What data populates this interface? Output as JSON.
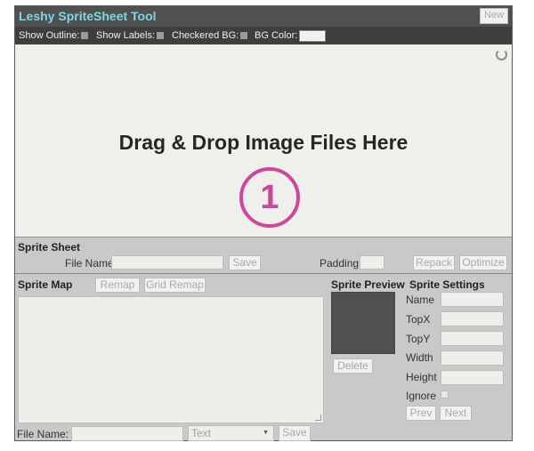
{
  "app": {
    "title": "Leshy SpriteSheet Tool",
    "new_label": "New"
  },
  "options": {
    "show_outline": "Show Outline:",
    "show_labels": "Show Labels:",
    "checkered_bg": "Checkered BG:",
    "bg_color": "BG Color:",
    "bg_color_value": "#f0f0f0"
  },
  "dropzone": {
    "text": "Drag & Drop Image Files Here",
    "step": "1"
  },
  "sprite_sheet": {
    "title": "Sprite Sheet",
    "file_name_label": "File Name:",
    "file_name_value": "",
    "save_label": "Save",
    "padding_label": "Padding:",
    "padding_value": "",
    "repack_label": "Repack",
    "optimize_label": "Optimize"
  },
  "sprite_map": {
    "title": "Sprite Map",
    "remap_label": "Remap",
    "grid_remap_label": "Grid Remap",
    "map_text": "",
    "file_name_label": "File Name:",
    "file_name_value": "",
    "format_selected": "Text",
    "save_label": "Save"
  },
  "sprite_preview": {
    "title": "Sprite Preview",
    "delete_label": "Delete"
  },
  "sprite_settings": {
    "title": "Sprite Settings",
    "name_label": "Name",
    "topx_label": "TopX",
    "topy_label": "TopY",
    "width_label": "Width",
    "height_label": "Height",
    "ignore_label": "Ignore",
    "prev_label": "Prev",
    "next_label": "Next"
  }
}
